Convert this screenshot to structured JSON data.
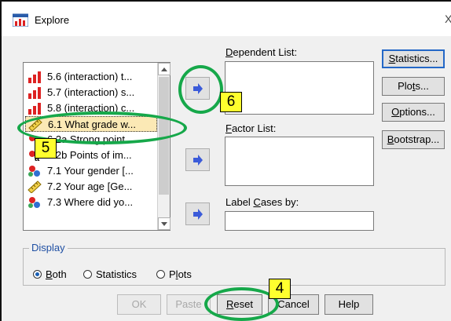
{
  "window": {
    "title": "Explore",
    "close_glyph": "X"
  },
  "variable_list": {
    "items": [
      {
        "label": "5.6 (interaction) t...",
        "icon": "ordinal-bar-icon"
      },
      {
        "label": "5.7 (interaction) s...",
        "icon": "ordinal-bar-icon"
      },
      {
        "label": "5.8 (interaction) c...",
        "icon": "ordinal-bar-icon"
      },
      {
        "label": "6.1 What grade w...",
        "icon": "scale-ruler-icon"
      },
      {
        "label": "6.2a Strong point...",
        "icon": "nominal-string-icon"
      },
      {
        "label": "6.2b Points of im...",
        "icon": "nominal-string-icon"
      },
      {
        "label": "7.1 Your gender [...",
        "icon": "nominal-people-icon"
      },
      {
        "label": "7.2 Your age [Ge...",
        "icon": "scale-ruler-icon"
      },
      {
        "label": "7.3 Where did yo...",
        "icon": "nominal-people-icon"
      }
    ]
  },
  "dependent_list": {
    "pre": "",
    "accel": "D",
    "post": "ependent List:"
  },
  "factor_list": {
    "pre": "",
    "accel": "F",
    "post": "actor List:"
  },
  "label_cases": {
    "pre": "Label ",
    "accel": "C",
    "post": "ases by:"
  },
  "side_buttons": {
    "statistics": {
      "pre": "",
      "accel": "S",
      "post": "tatistics..."
    },
    "plots": {
      "pre": "Plo",
      "accel": "t",
      "post": "s..."
    },
    "options": {
      "pre": "",
      "accel": "O",
      "post": "ptions..."
    },
    "bootstrap": {
      "pre": "",
      "accel": "B",
      "post": "ootstrap..."
    }
  },
  "display": {
    "title": "Display",
    "options": [
      {
        "pre": "",
        "accel": "B",
        "post": "oth",
        "selected": true
      },
      {
        "pre": "",
        "accel": "",
        "post": "Statistics",
        "selected": false
      },
      {
        "pre": "P",
        "accel": "l",
        "post": "ots",
        "selected": false
      }
    ]
  },
  "bottom_buttons": {
    "ok": "OK",
    "paste": "Paste",
    "reset": {
      "pre": "",
      "accel": "R",
      "post": "eset"
    },
    "cancel": "Cancel",
    "help": "Help"
  },
  "callouts": {
    "c4": "4",
    "c5": "5",
    "c6": "6"
  },
  "colors": {
    "callout_fill": "#ffff2e",
    "ring": "#16a84a",
    "arrow": "#3b5bd9",
    "focus": "#2468c7"
  }
}
